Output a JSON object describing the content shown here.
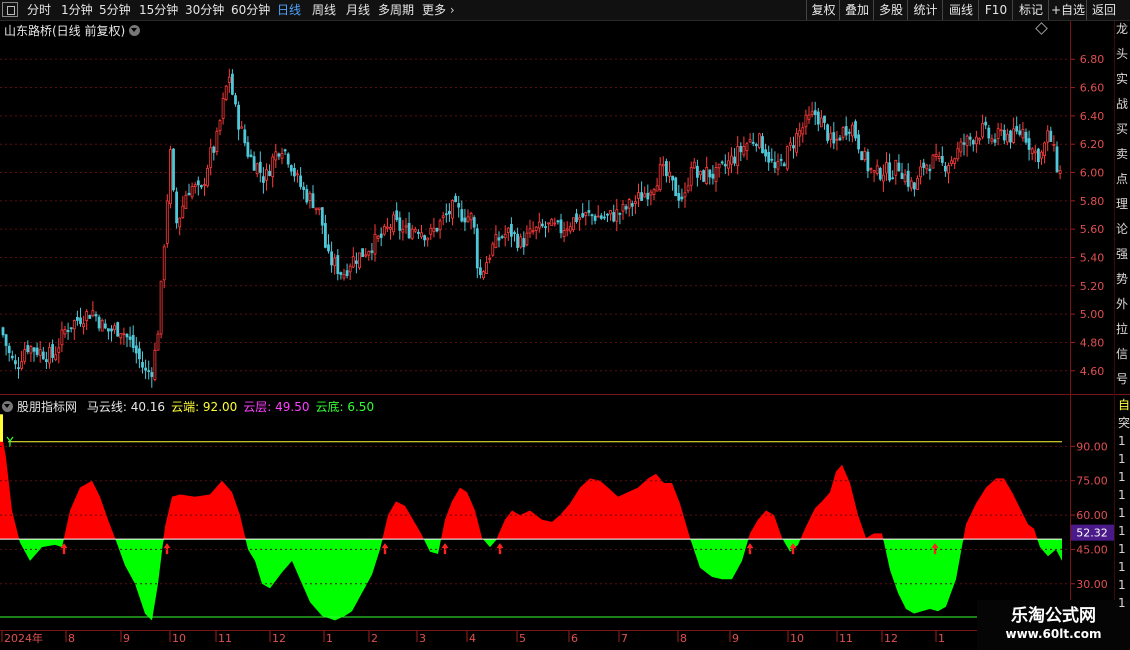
{
  "toolbar": {
    "periods": [
      "分时",
      "1分钟",
      "5分钟",
      "15分钟",
      "30分钟",
      "60分钟",
      "日线",
      "周线",
      "月线",
      "多周期",
      "更多"
    ],
    "active_period": "日线",
    "right_buttons": [
      "复权",
      "叠加",
      "多股",
      "统计",
      "画线",
      "F10",
      "标记",
      "+自选",
      "返回"
    ]
  },
  "price_chart": {
    "title": "山东路桥(日线 前复权)",
    "y_ticks": [
      "6.80",
      "6.60",
      "6.40",
      "6.20",
      "6.00",
      "5.80",
      "5.60",
      "5.40",
      "5.20",
      "5.00",
      "4.80",
      "4.60"
    ],
    "ylim": [
      4.45,
      6.95
    ],
    "up_color": "#ff3b3b",
    "down_color": "#4ec8d8"
  },
  "indicator": {
    "name": "股朋指标网",
    "items": [
      {
        "label": "马云线: 40.16",
        "color": "#e6e6e6"
      },
      {
        "label": "云端: 92.00",
        "color": "#ffff33"
      },
      {
        "label": "云层: 49.50",
        "color": "#ff40ff"
      },
      {
        "label": "云底: 6.50",
        "color": "#33ff33"
      }
    ],
    "y_ticks": [
      "90.00",
      "75.00",
      "60.00",
      "45.00",
      "30.00"
    ],
    "current_value": "52.32",
    "ylim": [
      12,
      105
    ],
    "cloud_top": 92,
    "cloud_mid": 49.5,
    "cloud_bottom": 6.5,
    "above_color": "#ff0000",
    "below_color": "#00ff00"
  },
  "x_axis": {
    "labels": [
      "2024年",
      "8",
      "9",
      "10",
      "11",
      "12",
      "1",
      "2",
      "3",
      "4",
      "5",
      "6",
      "7",
      "8",
      "9",
      "10",
      "11",
      "12",
      "1"
    ]
  },
  "right_strip_glyphs": [
    "龙",
    "头",
    "实",
    "战",
    "买",
    "卖",
    "点",
    "理",
    "论",
    "强",
    "势",
    "外",
    "拉",
    "信",
    "号"
  ],
  "right_strip_bottom": [
    "自",
    "突",
    "1",
    "1",
    "1",
    "1",
    "1",
    "1",
    "1",
    "1",
    "1",
    "1"
  ],
  "watermark": {
    "line1": "乐淘公式网",
    "line2": "www.60lt.com"
  },
  "chart_data": [
    {
      "type": "candlestick",
      "title": "山东路桥(日线 前复权)",
      "x_labels": [
        "2024年",
        "8",
        "9",
        "10",
        "11",
        "12",
        "1",
        "2",
        "3",
        "4",
        "5",
        "6",
        "7",
        "8",
        "9",
        "10",
        "11",
        "12",
        "1"
      ],
      "ylim": [
        4.45,
        6.95
      ],
      "close_path": [
        [
          0,
          4.9
        ],
        [
          8,
          4.72
        ],
        [
          15,
          4.62
        ],
        [
          25,
          4.78
        ],
        [
          38,
          4.74
        ],
        [
          52,
          4.7
        ],
        [
          65,
          4.9
        ],
        [
          80,
          4.98
        ],
        [
          92,
          5.02
        ],
        [
          105,
          4.88
        ],
        [
          120,
          4.9
        ],
        [
          133,
          4.76
        ],
        [
          145,
          4.58
        ],
        [
          152,
          4.62
        ],
        [
          158,
          4.95
        ],
        [
          164,
          5.6
        ],
        [
          170,
          6.18
        ],
        [
          174,
          5.62
        ],
        [
          180,
          5.72
        ],
        [
          186,
          5.88
        ],
        [
          192,
          5.9
        ],
        [
          200,
          5.85
        ],
        [
          208,
          6.1
        ],
        [
          215,
          6.2
        ],
        [
          222,
          6.48
        ],
        [
          228,
          6.7
        ],
        [
          234,
          6.45
        ],
        [
          240,
          6.3
        ],
        [
          248,
          6.12
        ],
        [
          256,
          6.05
        ],
        [
          264,
          5.95
        ],
        [
          272,
          6.1
        ],
        [
          280,
          6.2
        ],
        [
          288,
          6.1
        ],
        [
          296,
          5.95
        ],
        [
          304,
          5.85
        ],
        [
          312,
          5.8
        ],
        [
          320,
          5.7
        ],
        [
          326,
          5.4
        ],
        [
          334,
          5.35
        ],
        [
          342,
          5.28
        ],
        [
          350,
          5.38
        ],
        [
          360,
          5.42
        ],
        [
          372,
          5.5
        ],
        [
          382,
          5.55
        ],
        [
          392,
          5.65
        ],
        [
          404,
          5.58
        ],
        [
          416,
          5.62
        ],
        [
          428,
          5.55
        ],
        [
          440,
          5.65
        ],
        [
          452,
          5.75
        ],
        [
          462,
          5.7
        ],
        [
          472,
          5.68
        ],
        [
          478,
          5.25
        ],
        [
          484,
          5.35
        ],
        [
          492,
          5.48
        ],
        [
          500,
          5.55
        ],
        [
          510,
          5.58
        ],
        [
          520,
          5.5
        ],
        [
          532,
          5.58
        ],
        [
          545,
          5.62
        ],
        [
          560,
          5.6
        ],
        [
          575,
          5.68
        ],
        [
          590,
          5.7
        ],
        [
          605,
          5.68
        ],
        [
          620,
          5.72
        ],
        [
          635,
          5.8
        ],
        [
          648,
          5.88
        ],
        [
          655,
          5.95
        ],
        [
          660,
          6.02
        ],
        [
          668,
          5.95
        ],
        [
          676,
          5.85
        ],
        [
          684,
          5.82
        ],
        [
          690,
          6.08
        ],
        [
          698,
          5.95
        ],
        [
          706,
          6.0
        ],
        [
          715,
          5.98
        ],
        [
          725,
          6.05
        ],
        [
          735,
          6.12
        ],
        [
          745,
          6.2
        ],
        [
          755,
          6.25
        ],
        [
          765,
          6.15
        ],
        [
          775,
          6.0
        ],
        [
          785,
          6.12
        ],
        [
          795,
          6.25
        ],
        [
          805,
          6.35
        ],
        [
          815,
          6.42
        ],
        [
          825,
          6.3
        ],
        [
          832,
          6.18
        ],
        [
          840,
          6.28
        ],
        [
          850,
          6.35
        ],
        [
          858,
          6.2
        ],
        [
          866,
          6.05
        ],
        [
          874,
          5.98
        ],
        [
          882,
          6.02
        ],
        [
          890,
          6.0
        ],
        [
          898,
          6.05
        ],
        [
          906,
          5.95
        ],
        [
          914,
          5.88
        ],
        [
          922,
          6.05
        ],
        [
          932,
          6.08
        ],
        [
          942,
          6.05
        ],
        [
          952,
          6.1
        ],
        [
          962,
          6.2
        ],
        [
          972,
          6.25
        ],
        [
          982,
          6.3
        ],
        [
          992,
          6.22
        ],
        [
          1002,
          6.28
        ],
        [
          1012,
          6.25
        ],
        [
          1022,
          6.3
        ],
        [
          1032,
          6.15
        ],
        [
          1040,
          6.12
        ],
        [
          1048,
          6.28
        ],
        [
          1056,
          6.05
        ],
        [
          1062,
          5.95
        ]
      ]
    },
    {
      "type": "area",
      "title": "股朋指标网",
      "series": [
        {
          "name": "马云线",
          "x": [
            0,
            6,
            12,
            20,
            30,
            42,
            55,
            62,
            70,
            80,
            92,
            100,
            108,
            115,
            125,
            135,
            145,
            152,
            158,
            165,
            172,
            180,
            195,
            210,
            222,
            232,
            240,
            248,
            255,
            262,
            270,
            282,
            292,
            300,
            310,
            322,
            335,
            345,
            352,
            362,
            372,
            380,
            388,
            396,
            405,
            413,
            421,
            430,
            438,
            445,
            452,
            460,
            467,
            475,
            482,
            490,
            496,
            505,
            512,
            520,
            530,
            542,
            552,
            560,
            570,
            580,
            590,
            600,
            608,
            618,
            628,
            638,
            648,
            656,
            664,
            672,
            680,
            690,
            700,
            712,
            722,
            732,
            742,
            750,
            758,
            766,
            774,
            782,
            790,
            798,
            806,
            815,
            822,
            830,
            836,
            842,
            850,
            858,
            866,
            874,
            882,
            890,
            898,
            906,
            914,
            922,
            930,
            938,
            946,
            956,
            966,
            976,
            986,
            996,
            1004,
            1012,
            1020,
            1028,
            1034,
            1040,
            1048,
            1056,
            1062
          ],
          "values": [
            100,
            85,
            62,
            48,
            40,
            46,
            47,
            46,
            62,
            72,
            75,
            68,
            58,
            50,
            38,
            30,
            17,
            14,
            30,
            55,
            68,
            69,
            68,
            69,
            75,
            70,
            60,
            45,
            40,
            30,
            28,
            35,
            40,
            32,
            22,
            16,
            14,
            16,
            18,
            26,
            34,
            45,
            60,
            66,
            64,
            58,
            52,
            44,
            43,
            58,
            66,
            72,
            70,
            62,
            50,
            46,
            49,
            58,
            62,
            60,
            62,
            58,
            57,
            60,
            65,
            72,
            76,
            75,
            72,
            68,
            70,
            72,
            76,
            78,
            74,
            74,
            65,
            50,
            37,
            33,
            32,
            32,
            40,
            52,
            58,
            62,
            60,
            50,
            44,
            47,
            55,
            63,
            66,
            70,
            79,
            82,
            74,
            60,
            50,
            52,
            52,
            36,
            26,
            19,
            17,
            18,
            19,
            18,
            20,
            32,
            56,
            65,
            72,
            76,
            76,
            70,
            63,
            56,
            54,
            46,
            42,
            45,
            40
          ]
        }
      ],
      "ylim": [
        12,
        105
      ]
    }
  ]
}
